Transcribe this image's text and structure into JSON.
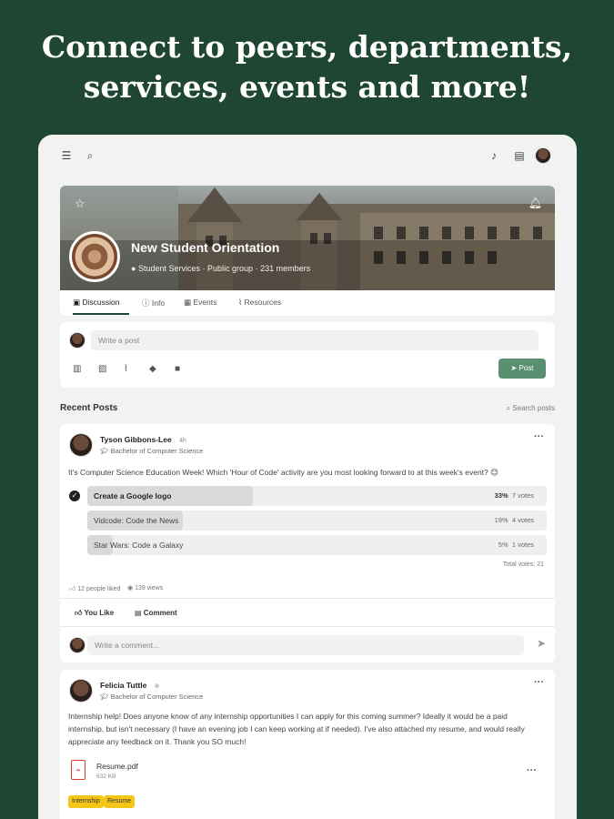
{
  "headline": {
    "line1": "Connect to peers, departments,",
    "line2": "services, events and more!"
  },
  "topbar": {
    "menu_icon": "menu-icon",
    "search_icon": "search-icon",
    "bell_icon": "bell-icon",
    "chat_icon": "chat-icon"
  },
  "group": {
    "name": "New Student Orientation",
    "category": "Student Services",
    "privacy": "Public group",
    "members": "231 members"
  },
  "tabs": [
    {
      "label": "Discussion"
    },
    {
      "label": "Info"
    },
    {
      "label": "Events"
    },
    {
      "label": "Resources"
    }
  ],
  "composer": {
    "placeholder": "Write a post",
    "post_label": "Post"
  },
  "recent": {
    "title": "Recent Posts",
    "search": "Search posts"
  },
  "post1": {
    "author": "Tyson Gibbons-Lee",
    "time": "4h",
    "degree": "Bachelor of Computer Science",
    "body": "It's Computer Science Education Week! Which 'Hour of Code' activity are you most looking forward to at this week's event? 😊",
    "poll": [
      {
        "label": "Create a Google logo",
        "pct": "33%",
        "votes": "7 votes",
        "fraction": 0.33,
        "selected": true
      },
      {
        "label": "Vidcode: Code the News",
        "pct": "19%",
        "votes": "4 votes",
        "fraction": 0.19,
        "selected": false
      },
      {
        "label": "Star Wars: Code a Galaxy",
        "pct": "5%",
        "votes": "1 votes",
        "fraction": 0.05,
        "selected": false
      }
    ],
    "total_votes": "Total votes: 21",
    "likes": "12 people liked",
    "views": "139 views",
    "you_like": "You Like",
    "comment": "Comment",
    "comment_placeholder": "Write a comment..."
  },
  "post2": {
    "author": "Felicia Tuttle",
    "degree": "Bachelor of Computer Science",
    "body": "Internship help! Does anyone know of any internship opportunities I can apply for this coming summer? Ideally it would be a paid internship, but isn't necessary (I have an evening job I can keep working at if needed). I've also attached my resume, and would really appreciate any feedback on it. Thank you SO much!",
    "file_name": "Resume.pdf",
    "file_size": "632 KB",
    "tags": [
      "Internship",
      "Resume"
    ]
  }
}
